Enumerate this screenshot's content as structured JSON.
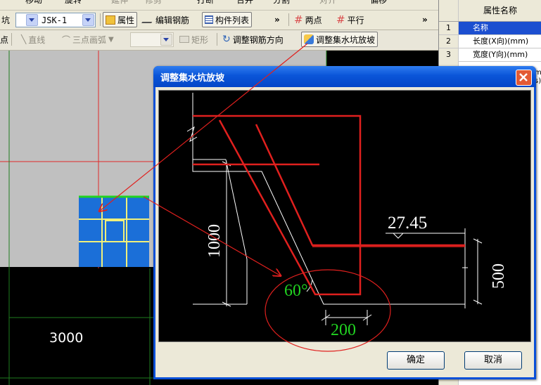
{
  "toolbar0": {
    "items": [
      "移动",
      "旋转",
      "延伸",
      "修剪",
      "打断",
      "合并",
      "分割",
      "对齐",
      "偏移"
    ]
  },
  "toolbar1": {
    "type_select": "坑",
    "component_select": "JSK-1",
    "properties_btn": "属性",
    "edit_rebar_btn": "编辑钢筋",
    "component_list_btn": "构件列表",
    "more_glyph": "»",
    "two_points": "两点",
    "parallel": "平行",
    "more_glyph_right": "»"
  },
  "toolbar2": {
    "point": "点",
    "line": "直线",
    "three_point_arc": "三点画弧",
    "rect": "矩形",
    "adjust_rebar_dir": "调整钢筋方向",
    "adjust_sump_slope": "调整集水坑放坡"
  },
  "viewport": {
    "dimension_label": "3000"
  },
  "properties_panel": {
    "header": "属性名称",
    "rows": [
      {
        "num": "1",
        "name": "名称"
      },
      {
        "num": "2",
        "name": "长度(X向)(mm)"
      },
      {
        "num": "3",
        "name": "宽度(Y向)(mm)"
      }
    ],
    "clipped_right": [
      "m",
      "s)"
    ]
  },
  "dialog": {
    "title": "调整集水坑放坡",
    "ok": "确定",
    "cancel": "取消",
    "drawing": {
      "depth": "1000",
      "elevation": "27.45",
      "thickness": "500",
      "angle": "60°",
      "offset": "200"
    }
  },
  "colors": {
    "title_blue": "#0a55d8",
    "rebar_red": "#e0201e",
    "label_green": "#21d321",
    "toolbar_bg": "#ece9d8"
  }
}
